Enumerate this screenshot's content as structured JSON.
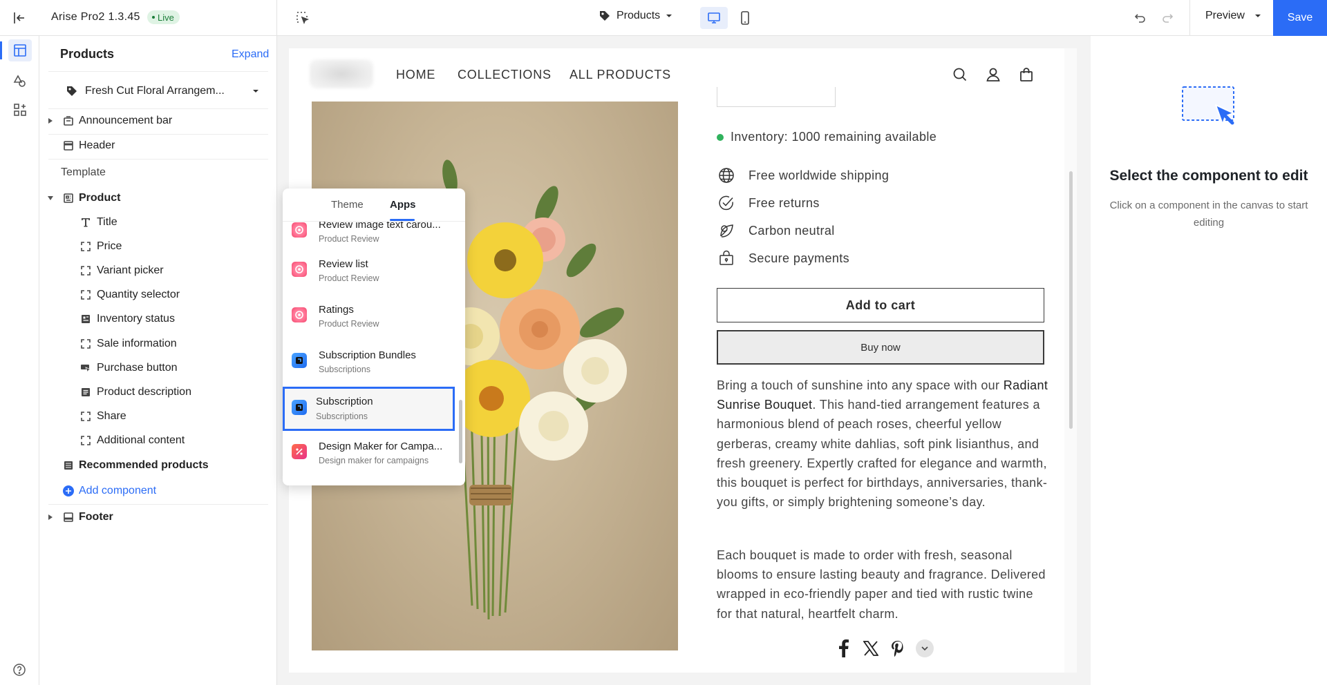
{
  "topbar": {
    "theme_name": "Arise Pro2",
    "version": "1.3.45",
    "live_label": "Live",
    "page_selector": "Products",
    "preview_label": "Preview",
    "save_label": "Save"
  },
  "sidebar": {
    "title": "Products",
    "expand_label": "Expand",
    "product_selector": "Fresh Cut Floral Arrangem...",
    "items": [
      {
        "label": "Announcement bar"
      },
      {
        "label": "Header"
      },
      {
        "label": "Template"
      },
      {
        "label": "Product"
      },
      {
        "label": "Title"
      },
      {
        "label": "Price"
      },
      {
        "label": "Variant picker"
      },
      {
        "label": "Quantity selector"
      },
      {
        "label": "Inventory status"
      },
      {
        "label": "Sale information"
      },
      {
        "label": "Purchase button"
      },
      {
        "label": "Product description"
      },
      {
        "label": "Share"
      },
      {
        "label": "Additional content"
      },
      {
        "label": "Recommended products"
      },
      {
        "label": "Add component"
      },
      {
        "label": "Footer"
      }
    ]
  },
  "canvas": {
    "nav": [
      "HOME",
      "COLLECTIONS",
      "ALL PRODUCTS"
    ],
    "inventory": "Inventory: 1000 remaining available",
    "features": [
      "Free worldwide shipping",
      "Free returns",
      "Carbon neutral",
      "Secure payments"
    ],
    "add_to_cart": "Add to cart",
    "buy_now": "Buy now",
    "desc1_prefix": "Bring a touch of sunshine into any space with our ",
    "desc1_bold": "Radiant Sunrise Bouquet",
    "desc1_suffix": ". This hand-tied arrangement features a harmonious blend of peach roses, cheerful yellow gerberas, creamy white dahlias, soft pink lisianthus, and fresh greenery. Expertly crafted for elegance and warmth, this bouquet is perfect for birthdays, anniversaries, thank-you gifts, or simply brightening someone’s day.",
    "desc2": "Each bouquet is made to order with fresh, seasonal blooms to ensure lasting beauty and fragrance. Delivered wrapped in eco-friendly paper and tied with rustic twine for that natural, heartfelt charm."
  },
  "popup": {
    "tabs": [
      "Theme",
      "Apps"
    ],
    "active_tab": "Apps",
    "items": [
      {
        "name": "Review image text carou...",
        "sub": "Product Review",
        "icon": "review-app-icon"
      },
      {
        "name": "Review list",
        "sub": "Product Review",
        "icon": "review-app-icon"
      },
      {
        "name": "Ratings",
        "sub": "Product Review",
        "icon": "review-app-icon"
      },
      {
        "name": "Subscription Bundles",
        "sub": "Subscriptions",
        "icon": "subscription-app-icon"
      },
      {
        "name": "Subscription",
        "sub": "Subscriptions",
        "icon": "subscription-app-icon",
        "selected": true
      },
      {
        "name": "Design Maker for Campa...",
        "sub": "Design maker for campaigns",
        "icon": "design-maker-app-icon"
      }
    ]
  },
  "right_panel": {
    "title": "Select the component to edit",
    "subtitle": "Click on a component in the canvas to start editing"
  },
  "colors": {
    "accent": "#2b6cf6",
    "live_badge_bg": "#dff3e4",
    "inventory_dot": "#30b25d"
  }
}
